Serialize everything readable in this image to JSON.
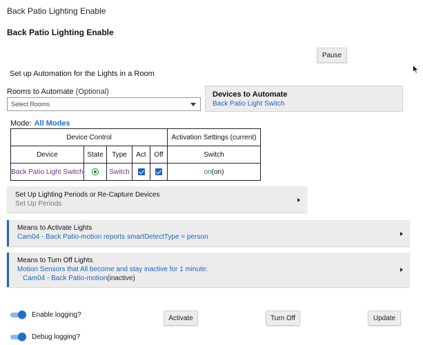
{
  "app": {
    "title": "Back Patio Lighting Enable"
  },
  "page": {
    "title": "Back Patio Lighting Enable"
  },
  "pause_label": "Pause",
  "setup_label": "Set up Automation for the Lights in a Room",
  "rooms": {
    "label": "Rooms to Automate",
    "optional": "(Optional)",
    "selected": "Select Rooms"
  },
  "devices": {
    "header": "Devices to Automate",
    "value": "Back Patio Light Switch"
  },
  "mode": {
    "label": "Mode:",
    "value": "All Modes"
  },
  "table": {
    "group_headers": {
      "device_control": "Device Control",
      "activation": "Activation Settings (current)"
    },
    "columns": {
      "device": "Device",
      "state": "State",
      "type": "Type",
      "act": "Act",
      "off": "Off",
      "switch": "Switch"
    },
    "rows": [
      {
        "device": "Back Patio Light Switch",
        "type": "Switch",
        "switch_on": "on",
        "switch_current": "(on)"
      }
    ]
  },
  "panels": {
    "periods": {
      "title": "Set Up Lighting Periods or Re-Capture Devices",
      "sub": "Set Up Periods"
    },
    "activate": {
      "title": "Means to Activate Lights",
      "sub": "Cam04 - Back Patio-motion reports smartDetectType = person"
    },
    "turnoff": {
      "title": "Means to Turn Off Lights",
      "sub": "Motion Sensors that All become and stay inactive for 1 minute:",
      "device": "Cam04 - Back Patio-motion",
      "device_state": "(inactive)"
    }
  },
  "toggles": {
    "enable_logging": "Enable logging?",
    "debug_logging": "Debug logging?"
  },
  "buttons": {
    "activate": "Activate",
    "turn_off": "Turn Off",
    "update": "Update"
  },
  "colors": {
    "accent": "#1e63c4",
    "link": "#1e73d6",
    "purple": "#7a2a8a",
    "green": "#1e8a1e"
  }
}
